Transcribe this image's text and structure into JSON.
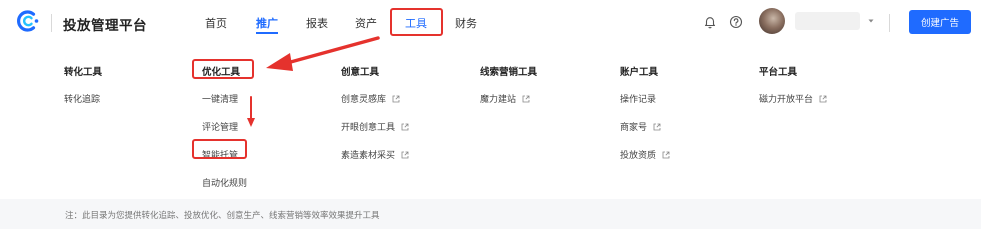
{
  "header": {
    "brand_name": "投放管理平台",
    "nav": [
      {
        "label": "首页"
      },
      {
        "label": "推广",
        "active": true
      },
      {
        "label": "报表"
      },
      {
        "label": "资产"
      },
      {
        "label": "工具"
      },
      {
        "label": "财务"
      }
    ],
    "create_button": "创建广告",
    "icons": [
      "bell-icon",
      "help-icon",
      "avatar",
      "chevron-down-icon"
    ]
  },
  "menu": {
    "columns": [
      {
        "title": "转化工具",
        "items": [
          {
            "label": "转化追踪",
            "external": false
          }
        ]
      },
      {
        "title": "优化工具",
        "items": [
          {
            "label": "一键清理",
            "external": false
          },
          {
            "label": "评论管理",
            "external": false
          },
          {
            "label": "智能托管",
            "external": false
          },
          {
            "label": "自动化规则",
            "external": false
          }
        ]
      },
      {
        "title": "创意工具",
        "items": [
          {
            "label": "创意灵感库",
            "external": true
          },
          {
            "label": "开眼创意工具",
            "external": true
          },
          {
            "label": "素造素材采买",
            "external": true
          }
        ]
      },
      {
        "title": "线索营销工具",
        "items": [
          {
            "label": "魔力建站",
            "external": true
          }
        ]
      },
      {
        "title": "账户工具",
        "items": [
          {
            "label": "操作记录",
            "external": false
          },
          {
            "label": "商家号",
            "external": true
          },
          {
            "label": "投放资质",
            "external": true
          }
        ]
      },
      {
        "title": "平台工具",
        "items": [
          {
            "label": "磁力开放平台",
            "external": true
          }
        ]
      }
    ]
  },
  "footer": {
    "note": "注：此目录为您提供转化追踪、投放优化、创意生产、线索营销等效率效果提升工具"
  },
  "colors": {
    "accent": "#1f6bff",
    "annotation_red": "#e5322d"
  }
}
